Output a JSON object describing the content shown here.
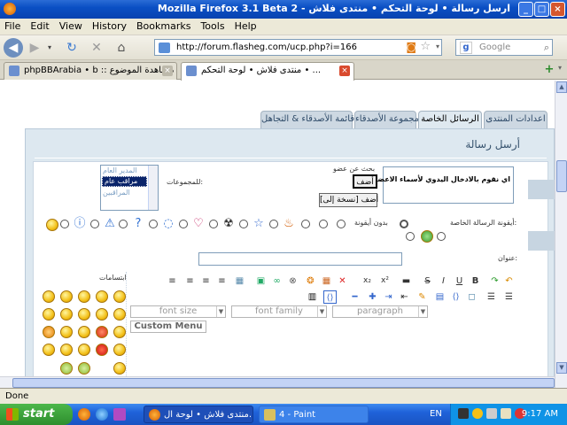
{
  "window": {
    "title": "ارسل رسالة • لوحة التحكم • منتدى فلاش - Mozilla Firefox 3.1 Beta 2",
    "controls": [
      "_",
      "□",
      "×"
    ]
  },
  "menu": [
    "File",
    "Edit",
    "View",
    "History",
    "Bookmarks",
    "Tools",
    "Help"
  ],
  "nav": {
    "url": "http://forum.flasheg.com/ucp.php?i=166",
    "search_placeholder": "Google",
    "search_letter": "g"
  },
  "browser_tabs": [
    {
      "label": "phpBBArabia • b :: مشاهدة الموضوع",
      "active": false
    },
    {
      "label": "منتدى فلاش • لوحة التحكم • ...",
      "active": true
    }
  ],
  "page": {
    "tabs": [
      "قائمة الأصدقاء & التجاهل",
      "مجموعة الأصدقاء",
      "الرسائل الخاصة",
      "اعدادات المنتدى"
    ],
    "active_tab": 2,
    "panel_title": "أرسل رسالة",
    "recipient_hint": "اي نقوم بالادخال اليدوي لأسماء الاعضاء",
    "find_member": "بحث عن عضو",
    "add_button": "أضف",
    "add_bcc_button": "أضف [نسخة إلى]",
    "groups_label": "للمجموعات:",
    "groups": [
      "المدير العام",
      "مراقب عام",
      "المراقبين"
    ],
    "groups_selected": 1,
    "pm_icon_label": "أيقونة الرسالة الخاصة:",
    "no_icon": "بدون أيقونة",
    "subject_label": "عنوان:",
    "smilies_label": "ابتسامات",
    "font_size": "font size",
    "font_family": "font family",
    "paragraph": "paragraph",
    "custom_menu": "Custom Menu",
    "toolbar_text": [
      "B",
      "U",
      "I",
      "S",
      "x²",
      "x₂"
    ]
  },
  "status": "Done",
  "taskbar": {
    "start": "start",
    "tasks": [
      "منتدى فلاش • لوحة ال...",
      "4 - Paint"
    ],
    "lang": "EN",
    "clock": "9:17 AM"
  },
  "colors": {
    "titlebar": "#0a4fc4",
    "panel": "#dde8f0",
    "tab": "#cdd8e2",
    "taskbar": "#1f62d9",
    "start": "#2e8e2e"
  }
}
